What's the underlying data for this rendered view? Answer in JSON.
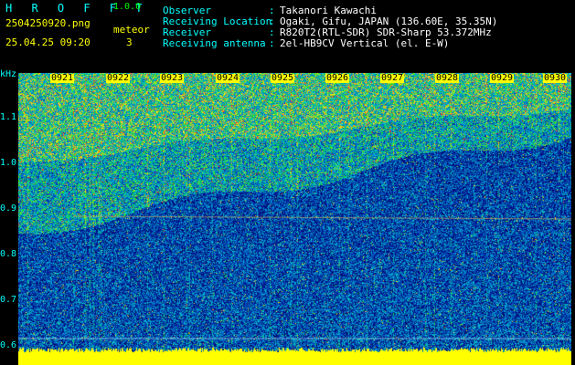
{
  "header": {
    "app_name": "H R O F F T",
    "version": "1.0.0",
    "filename": "2504250920.png",
    "mode": "meteor",
    "datetime": "25.04.25 09:20",
    "count": "3"
  },
  "info": [
    {
      "label": "Observer",
      "value": "Takanori Kawachi"
    },
    {
      "label": "Receiving Location",
      "value": "Ogaki, Gifu, JAPAN (136.60E, 35.35N)"
    },
    {
      "label": "Receiver",
      "value": "R820T2(RTL-SDR) SDR-Sharp 53.372MHz"
    },
    {
      "label": "Receiving antenna",
      "value": "2el-HB9CV Vertical (el. E-W)"
    }
  ],
  "spectrogram": {
    "unit": "kHz",
    "y_ticks": [
      "1.1",
      "1.0",
      "0.9",
      "0.8",
      "0.7",
      "0.6"
    ],
    "time_labels": [
      "0921",
      "0922",
      "0923",
      "0924",
      "0925",
      "0926",
      "0927",
      "0928",
      "0929",
      "0930"
    ],
    "colors": {
      "background": "#000000",
      "text": "#ffff00",
      "label": "#00ffff",
      "noise_floor": "#ffff00"
    }
  }
}
